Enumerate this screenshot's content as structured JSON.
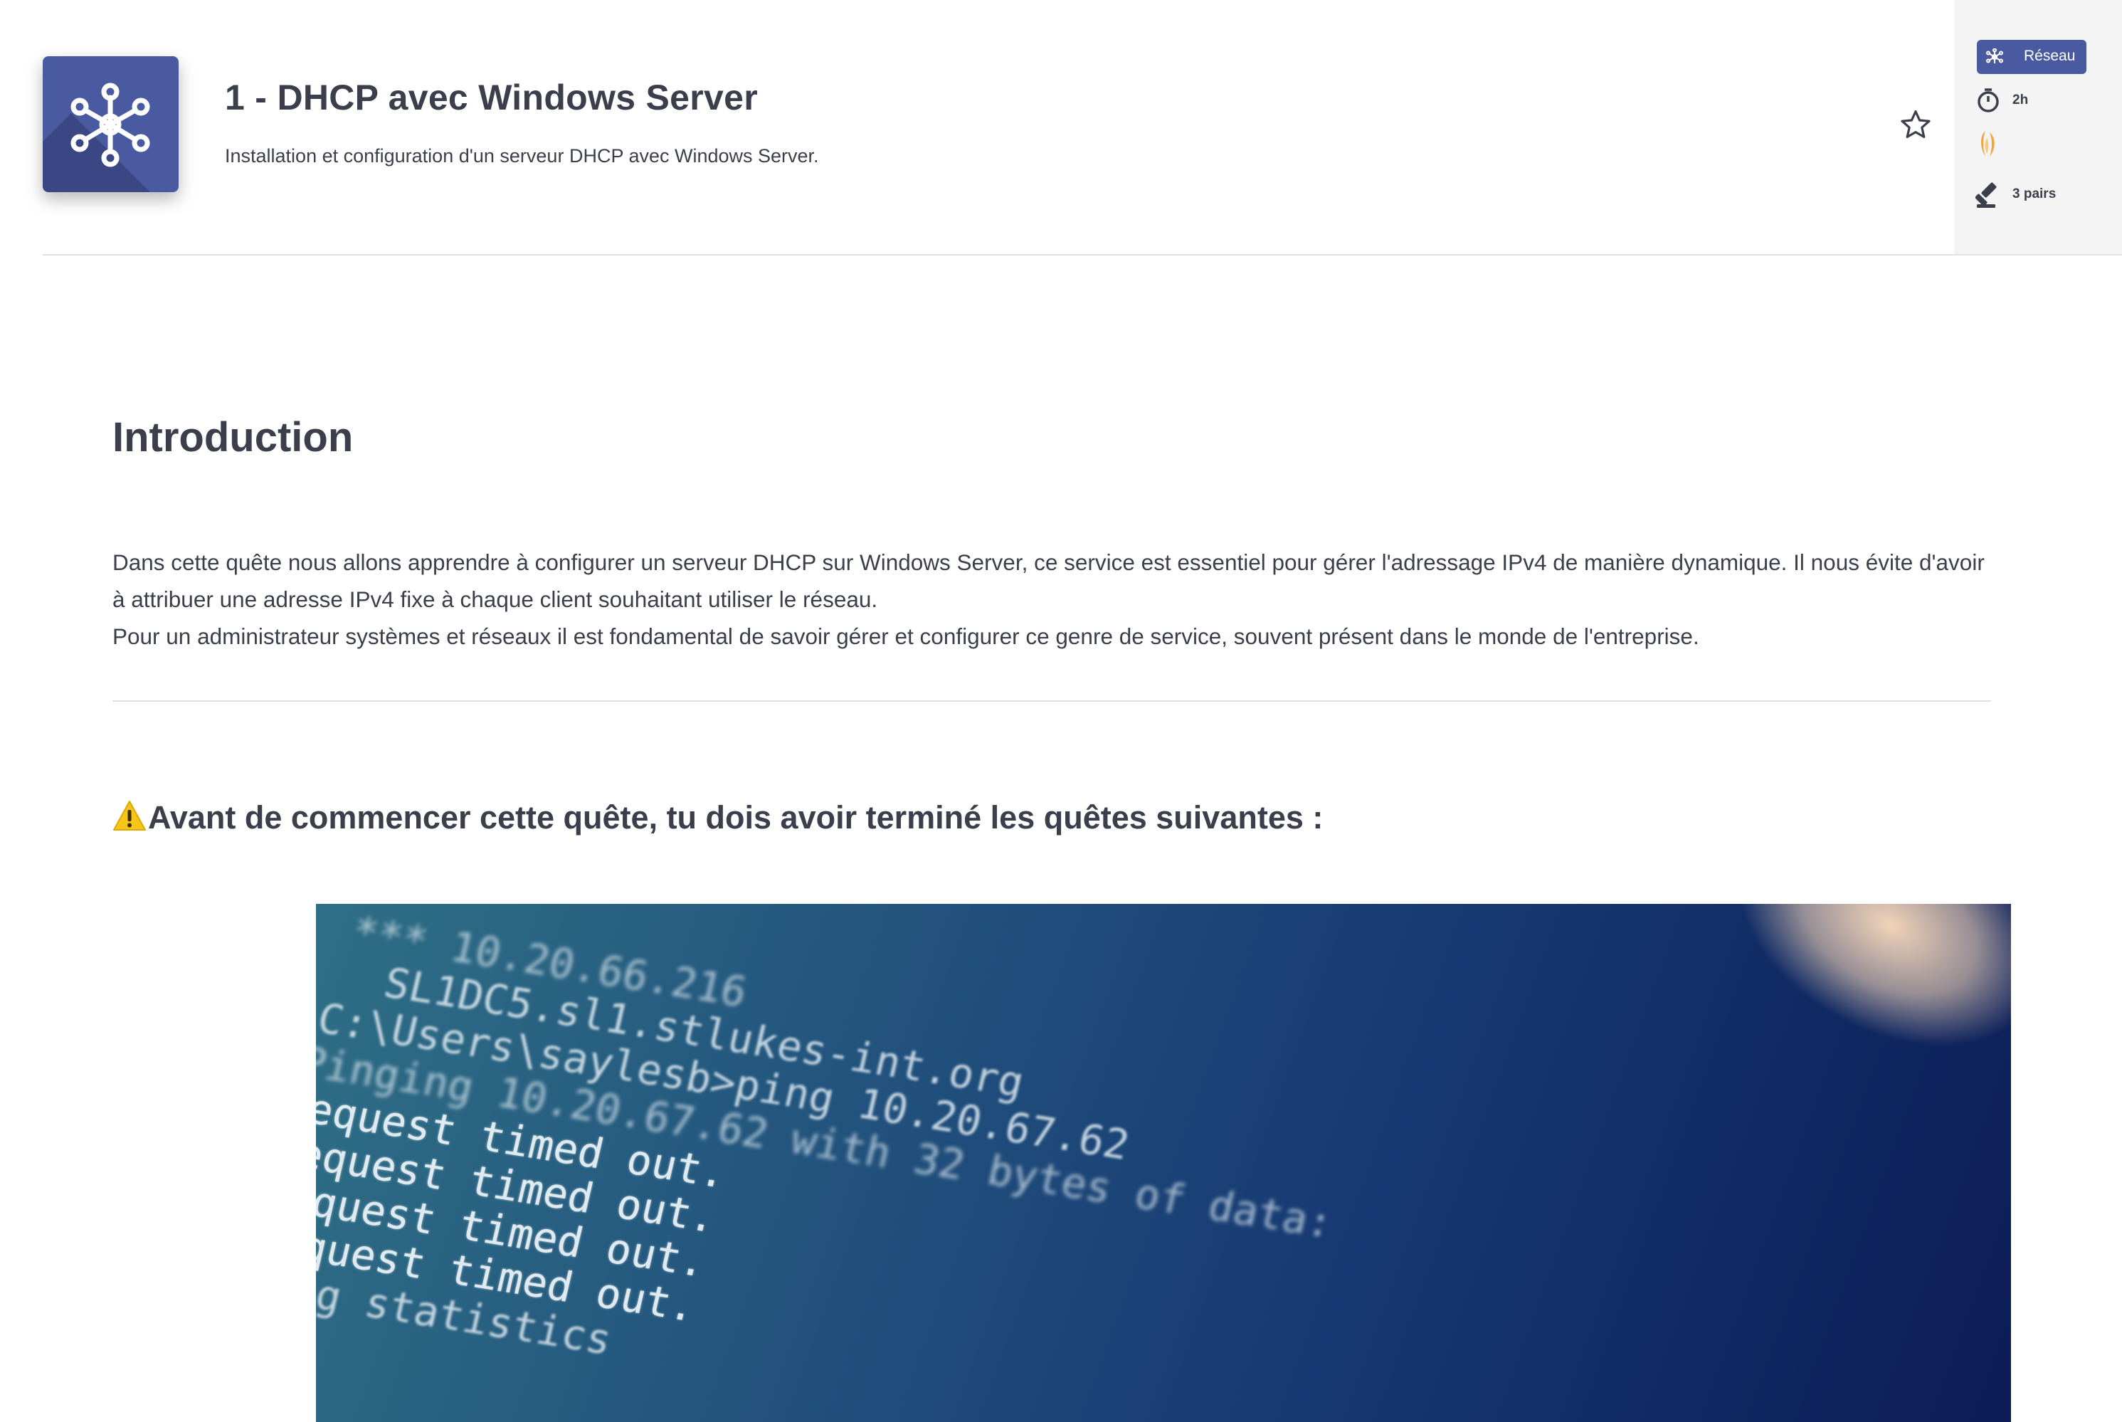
{
  "header": {
    "title": "1 - DHCP avec Windows Server",
    "subtitle": "Installation et configuration d'un serveur DHCP avec Windows Server.",
    "favorite_icon": "star-outline-icon",
    "quest_icon": "network-hub-icon"
  },
  "side_panel": {
    "category": "Réseau",
    "duration": "2h",
    "peers": "3 pairs",
    "colors": {
      "badge": "#4a5aa0",
      "difficulty": "#f0a53a"
    }
  },
  "content": {
    "section_title": "Introduction",
    "intro_paragraph_1": "Dans cette quête nous allons apprendre à configurer un serveur DHCP sur Windows Server, ce service est essentiel pour gérer l'adressage IPv4 de manière dynamique. Il nous évite d'avoir à attribuer une adresse IPv4 fixe à chaque client souhaitant utiliser le réseau.",
    "intro_paragraph_2": "Pour un administrateur systèmes et réseaux il est fondamental de savoir gérer et configurer ce genre de service, souvent présent dans le monde de l'entreprise.",
    "warning_icon": "⚠️",
    "warning_heading": "Avant de commencer cette quête, tu dois avoir terminé les quêtes suivantes :"
  },
  "terminal_image": {
    "lines": [
      "***   10.20.66.216",
      "SL1DC5.sl1.stlukes-int.org",
      "C:\\Users\\saylesb>ping 10.20.67.62",
      "Pinging 10.20.67.62 with 32 bytes of data:",
      "Request timed out.",
      "Request timed out.",
      "Request timed out.",
      "Request timed out.",
      "Ping statistics"
    ]
  }
}
